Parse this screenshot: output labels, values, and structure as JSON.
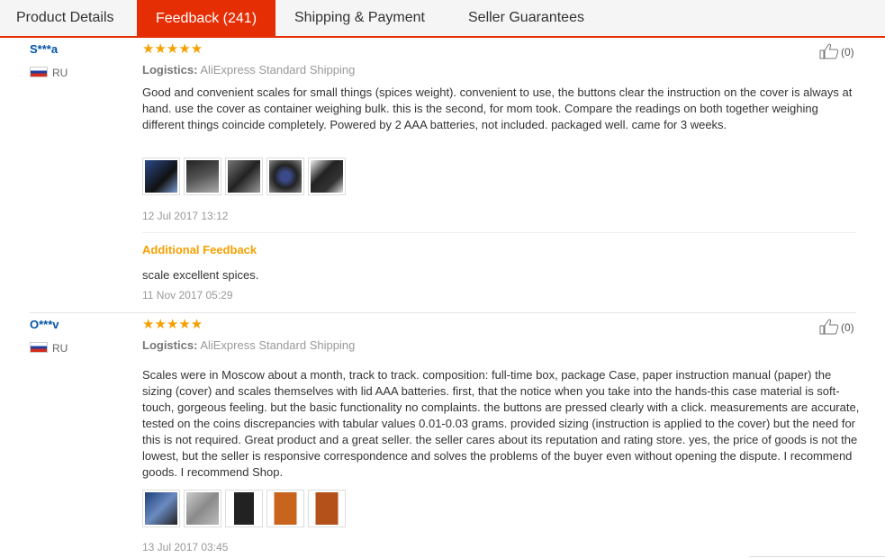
{
  "tabs": [
    {
      "label": "Product Details"
    },
    {
      "label": "Feedback (241)"
    },
    {
      "label": "Shipping & Payment"
    },
    {
      "label": "Seller Guarantees"
    }
  ],
  "reviews": [
    {
      "user": "S***a",
      "country": "RU",
      "stars": "★★★★★",
      "logistics_label": "Logistics:",
      "logistics_value": "AliExpress Standard Shipping",
      "text": "Good and convenient scales for small things (spices weight). convenient to use, the buttons clear the instruction on the cover is always at hand. use the cover as container weighing bulk. this is the second, for mom took. Compare the readings on both together weighing different things coincide completely. Powered by 2 AAA batteries, not included. packaged well. came for 3 weeks.",
      "date": "12 Jul 2017 13:12",
      "helpful": "(0)",
      "additional": {
        "title": "Additional Feedback",
        "text": "scale excellent spices.",
        "date": "11 Nov 2017 05:29"
      },
      "thumb_colors": [
        "#2a4a8a",
        "#3a3a3a",
        "#555555",
        "#2b2b2b",
        "#444444"
      ]
    },
    {
      "user": "O***v",
      "country": "RU",
      "stars": "★★★★★",
      "logistics_label": "Logistics:",
      "logistics_value": "AliExpress Standard Shipping",
      "text": "Scales were in Moscow about a month, track to track. composition: full-time box, package Case, paper instruction manual (paper) the sizing (cover) and scales themselves with lid AAA batteries. first, that the notice when you take into the hands-this case material is soft-touch, gorgeous feeling. but the basic functionality no complaints. the buttons are pressed clearly with a click. measurements are accurate, tested on the coins discrepancies with tabular values 0.01-0.03 grams. provided sizing (instruction is applied to the cover) but the need for this is not required. Great product and a great seller. the seller cares about its reputation and rating store. yes, the price of goods is not the lowest, but the seller is responsive correspondence and solves the problems of the buyer even without opening the dispute. I recommend goods. I recommend Shop.",
      "date": "13 Jul 2017 03:45",
      "helpful": "(0)",
      "thumb_colors": [
        "#1e3f7a",
        "#9a9a9a",
        "#2e2e2e",
        "#c8641e",
        "#b4501a"
      ]
    }
  ],
  "colors": {
    "accent": "#e62e04",
    "username": "#0055aa",
    "stars": "#f6a000",
    "muted": "#999999"
  },
  "icons": {
    "flag": "russia-flag-icon",
    "like": "thumbs-up-icon",
    "star": "star-icon"
  }
}
